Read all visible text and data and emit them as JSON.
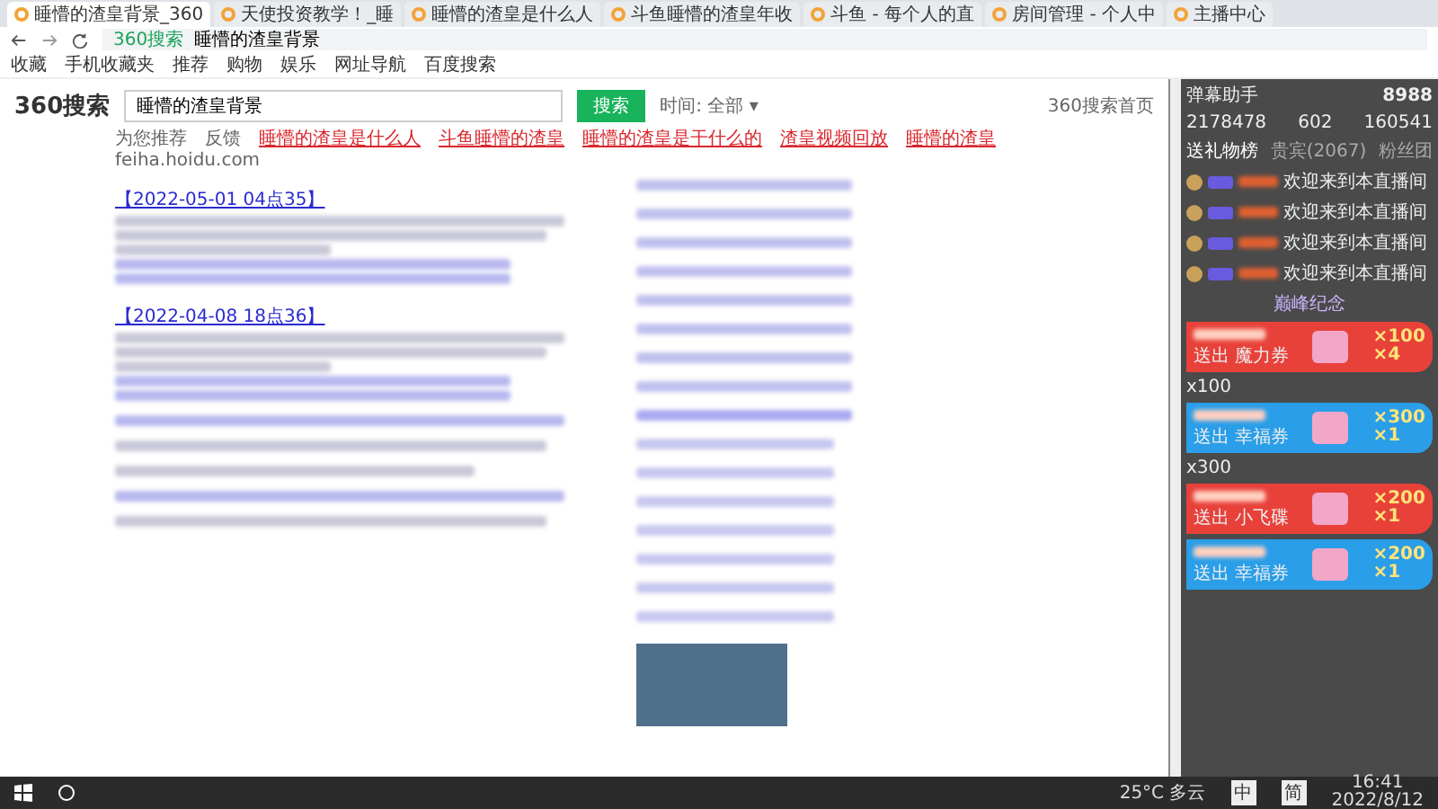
{
  "browser": {
    "tabs": [
      {
        "title": "睡懵的渣皇背景_360",
        "selected": true
      },
      {
        "title": "天使投资教学！_睡",
        "selected": false
      },
      {
        "title": "睡懵的渣皇是什么人",
        "selected": false
      },
      {
        "title": "斗鱼睡懵的渣皇年收",
        "selected": false
      },
      {
        "title": "斗鱼 - 每个人的直",
        "selected": false
      },
      {
        "title": "房间管理 - 个人中",
        "selected": false
      },
      {
        "title": "主播中心",
        "selected": false
      }
    ],
    "address": {
      "site": "360搜索",
      "text": "睡懵的渣皇背景"
    },
    "bookmarks": [
      "收藏",
      "手机收藏夹",
      "推荐",
      "购物",
      "娱乐",
      "网址导航",
      "百度搜索"
    ]
  },
  "search": {
    "logo": "360搜索",
    "query": "睡懵的渣皇背景",
    "button": "搜索",
    "time_filter": "时间: 全部 ▾",
    "recommend_label": "为您推荐",
    "feedback": "反馈",
    "suggestions": [
      "睡懵的渣皇是什么人",
      "斗鱼睡懵的渣皇",
      "睡懵的渣皇是干什么的",
      "渣皇视频回放",
      "睡懵的渣皇"
    ],
    "site_line": "feiha.hoidu.com",
    "results": [
      {
        "title": "【2022-05-01 04点35】"
      },
      {
        "title": "【2022-04-08 18点36】"
      }
    ],
    "top_link": "360搜索首页"
  },
  "panel": {
    "title": "弹幕助手",
    "count": "8988",
    "stats": [
      "2178478",
      "602",
      "160541"
    ],
    "tabs": [
      {
        "label": "送礼物榜",
        "selected": true
      },
      {
        "label": "贵宾(2067)",
        "selected": false
      },
      {
        "label": "粉丝团",
        "selected": false
      }
    ],
    "messages": [
      "欢迎来到本直播间",
      "欢迎来到本直播间",
      "欢迎来到本直播间",
      "欢迎来到本直播间"
    ],
    "banner": "巅峰纪念",
    "gifts": [
      {
        "count": "×100",
        "combo": "×4",
        "action": "送出",
        "item": "魔力券",
        "color": "#e8413a",
        "note": "x100"
      },
      {
        "count": "×300",
        "combo": "×1",
        "action": "送出",
        "item": "幸福券",
        "color": "#2a9ee8",
        "note": "x300"
      },
      {
        "count": "×200",
        "combo": "×1",
        "action": "送出",
        "item": "小飞碟",
        "color": "#e8413a"
      },
      {
        "count": "×200",
        "combo": "×1",
        "action": "送出",
        "item": "幸福券",
        "color": "#2a9ee8"
      }
    ]
  },
  "taskbar": {
    "weather": "25°C 多云",
    "time": "16:41",
    "date": "2022/8/12",
    "ime": [
      "中",
      "简"
    ]
  }
}
